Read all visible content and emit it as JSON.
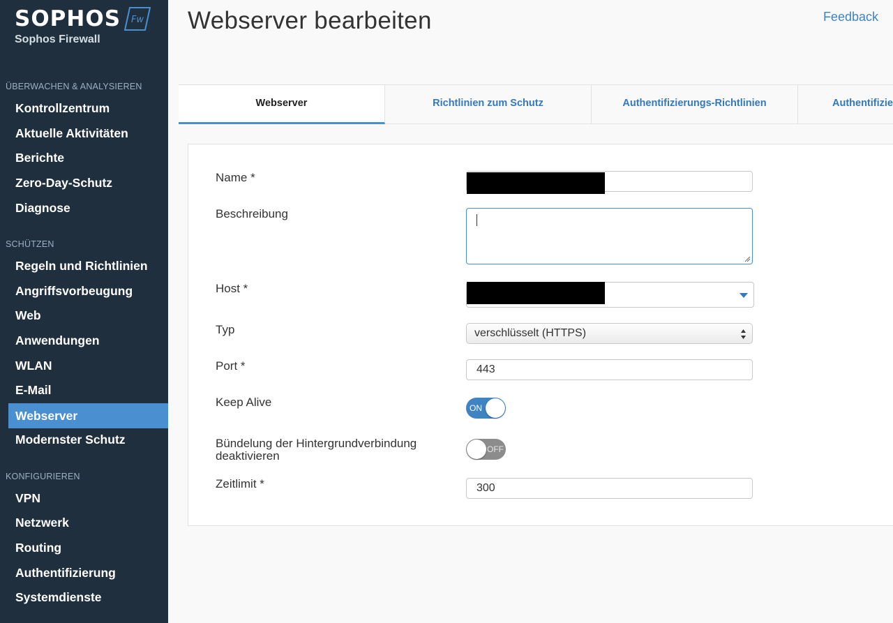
{
  "brand": {
    "logo": "SOPHOS",
    "product": "Sophos Firewall",
    "badge": "Fw"
  },
  "sidebar": {
    "sections": [
      {
        "label": "ÜBERWACHEN & ANALYSIEREN",
        "items": [
          "Kontrollzentrum",
          "Aktuelle Aktivitäten",
          "Berichte",
          "Zero-Day-Schutz",
          "Diagnose"
        ]
      },
      {
        "label": "SCHÜTZEN",
        "items": [
          "Regeln und Richtlinien",
          "Angriffsvorbeugung",
          "Web",
          "Anwendungen",
          "WLAN",
          "E-Mail",
          "Webserver",
          "Modernster Schutz"
        ]
      },
      {
        "label": "KONFIGURIEREN",
        "items": [
          "VPN",
          "Netzwerk",
          "Routing",
          "Authentifizierung",
          "Systemdienste"
        ]
      }
    ],
    "active_item": "Webserver"
  },
  "header": {
    "title": "Webserver bearbeiten",
    "feedback": "Feedback"
  },
  "tabs": [
    "Webserver",
    "Richtlinien zum Schutz",
    "Authentifizierungs-Richtlinien",
    "Authentifizie"
  ],
  "form": {
    "name_label": "Name *",
    "description_label": "Beschreibung",
    "host_label": "Host *",
    "type_label": "Typ",
    "type_value": "verschlüsselt (HTTPS)",
    "port_label": "Port *",
    "port_value": "443",
    "keepalive_label": "Keep Alive",
    "keepalive_state": "ON",
    "bundling_label_1": "Bündelung der Hintergrundverbindung",
    "bundling_label_2": "deaktivieren",
    "bundling_state": "OFF",
    "timeout_label": "Zeitlimit *",
    "timeout_value": "300"
  },
  "colors": {
    "sidebar_bg": "#1f2f3e",
    "accent": "#4a8fd0",
    "link": "#3478bd"
  }
}
